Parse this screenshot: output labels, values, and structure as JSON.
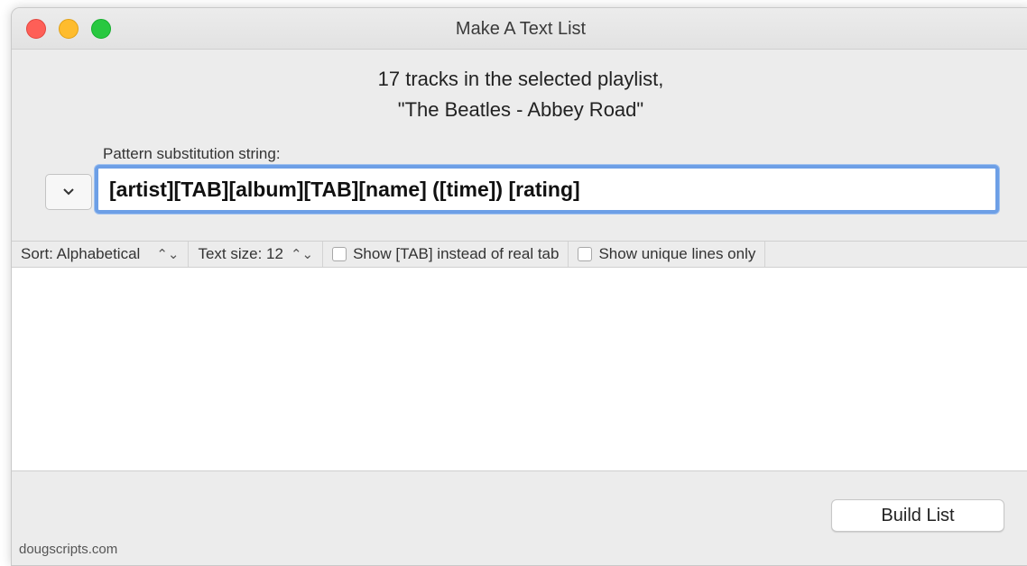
{
  "window": {
    "title": "Make A Text List"
  },
  "info": {
    "line1": "17 tracks in the selected playlist,",
    "line2": "\"The Beatles - Abbey Road\""
  },
  "pattern": {
    "label": "Pattern substitution string:",
    "value": "[artist][TAB][album][TAB][name] ([time]) [rating]",
    "dropdown_icon": "chevron-down-icon"
  },
  "options": {
    "sort_label": "Sort: Alphabetical",
    "text_size_label": "Text size: 12",
    "show_tab_label": "Show [TAB] instead of real tab",
    "unique_lines_label": "Show unique lines only",
    "show_tab_checked": false,
    "unique_lines_checked": false
  },
  "actions": {
    "build_label": "Build List"
  },
  "footer": {
    "credit": "dougscripts.com"
  },
  "colors": {
    "close": "#fe5f57",
    "minimize": "#febc2e",
    "zoom": "#28c840",
    "focus_ring": "#6d9fe6"
  }
}
